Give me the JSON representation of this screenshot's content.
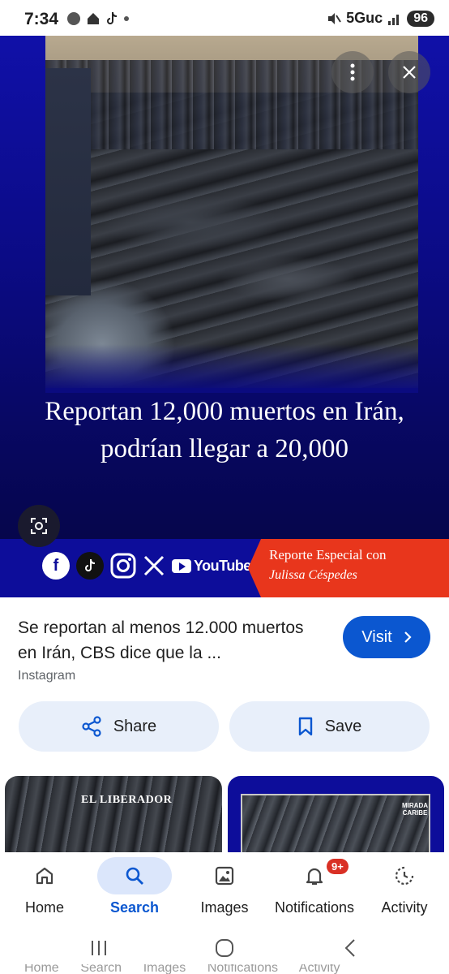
{
  "status_bar": {
    "time": "7:34",
    "network": "5Guc",
    "battery": "96"
  },
  "hero": {
    "headline": "Reportan 12,000 muertos en Irán, podrían llegar a 20,000",
    "youtube_label": "YouTube",
    "special_title": "Reporte Especial con",
    "special_name": "Julissa Céspedes"
  },
  "result": {
    "title": "Se reportan al menos 12.000 muertos en Irán, CBS dice que la ...",
    "source": "Instagram",
    "visit_label": "Visit",
    "share_label": "Share",
    "save_label": "Save"
  },
  "related": {
    "thumb1_label": "EL LIBERADOR",
    "thumb2_badge": "MIRADA CARIBE"
  },
  "nav": {
    "items": [
      {
        "label": "Home",
        "icon": "home-icon",
        "active": false
      },
      {
        "label": "Search",
        "icon": "search-icon",
        "active": true
      },
      {
        "label": "Images",
        "icon": "images-icon",
        "active": false
      },
      {
        "label": "Notifications",
        "icon": "bell-icon",
        "active": false,
        "badge": "9+"
      },
      {
        "label": "Activity",
        "icon": "activity-icon",
        "active": false
      }
    ]
  },
  "ghost_labels": "Home      Search      Images      Notifications      Activity",
  "colors": {
    "accent": "#0b57d0",
    "hero_blue": "#0d0d9a",
    "banner_red": "#e8361c",
    "badge_red": "#d93025"
  }
}
